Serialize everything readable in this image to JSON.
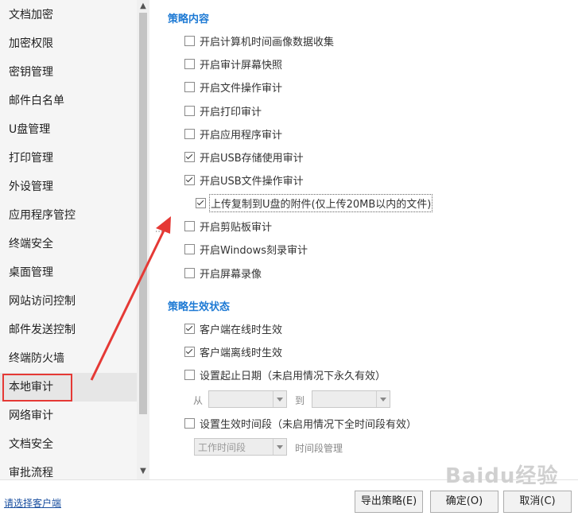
{
  "sidebar": {
    "items": [
      {
        "label": "文档加密"
      },
      {
        "label": "加密权限"
      },
      {
        "label": "密钥管理"
      },
      {
        "label": "邮件白名单"
      },
      {
        "label": "U盘管理"
      },
      {
        "label": "打印管理"
      },
      {
        "label": "外设管理"
      },
      {
        "label": "应用程序管控"
      },
      {
        "label": "终端安全"
      },
      {
        "label": "桌面管理"
      },
      {
        "label": "网站访问控制"
      },
      {
        "label": "邮件发送控制"
      },
      {
        "label": "终端防火墙"
      },
      {
        "label": "本地审计"
      },
      {
        "label": "网络审计"
      },
      {
        "label": "文档安全"
      },
      {
        "label": "审批流程"
      }
    ],
    "selected": "本地审计"
  },
  "policy_content": {
    "title": "策略内容",
    "options": [
      {
        "label": "开启计算机时间画像数据收集",
        "checked": false
      },
      {
        "label": "开启审计屏幕快照",
        "checked": false
      },
      {
        "label": "开启文件操作审计",
        "checked": false
      },
      {
        "label": "开启打印审计",
        "checked": false
      },
      {
        "label": "开启应用程序审计",
        "checked": false
      },
      {
        "label": "开启USB存储使用审计",
        "checked": true
      },
      {
        "label": "开启USB文件操作审计",
        "checked": true
      },
      {
        "label": "上传复制到U盘的附件(仅上传20MB以内的文件)",
        "checked": true
      },
      {
        "label": "开启剪贴板审计",
        "checked": false
      },
      {
        "label": "开启Windows刻录审计",
        "checked": false
      },
      {
        "label": "开启屏幕录像",
        "checked": false
      }
    ]
  },
  "policy_status": {
    "title": "策略生效状态",
    "online": {
      "label": "客户端在线时生效",
      "checked": true
    },
    "offline": {
      "label": "客户端离线时生效",
      "checked": true
    },
    "date_range": {
      "label": "设置起止日期（未启用情况下永久有效）",
      "checked": false,
      "from_label": "从",
      "to_label": "到"
    },
    "time_range": {
      "label": "设置生效时间段（未启用情况下全时间段有效）",
      "checked": false,
      "select_value": "工作时间段",
      "manage_label": "时间段管理"
    }
  },
  "footer": {
    "select_client_link": "请选择客户端",
    "export_button": "导出策略(E)",
    "ok_button": "确定(O)",
    "cancel_button": "取消(C)"
  },
  "watermark": "Baidu经验",
  "colors": {
    "accent": "#1e7ad4",
    "highlight": "#e53935",
    "link": "#1a4fa0"
  }
}
